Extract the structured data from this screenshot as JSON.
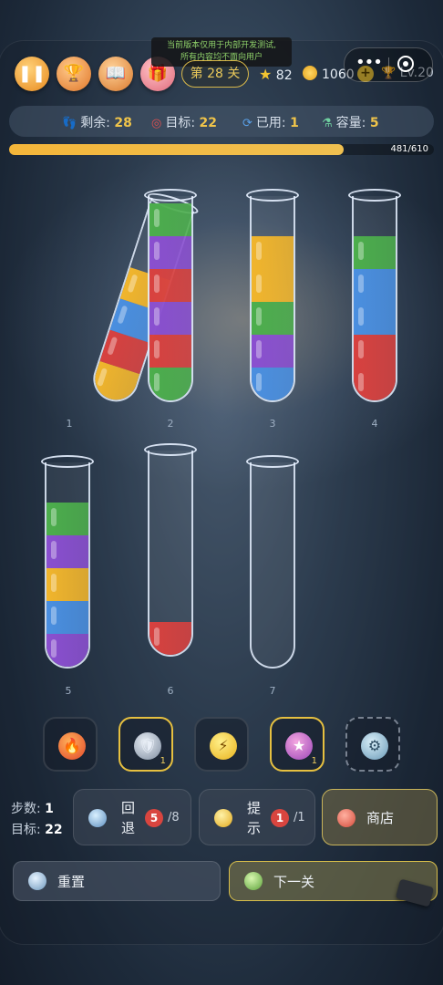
{
  "tooltip": {
    "line1": "当前版本仅用于内部开发测试,",
    "line2": "所有内容均不面向用户"
  },
  "header": {
    "level": "第 28 关",
    "stars": "82",
    "coins": "1060",
    "player_level": "Lv.20"
  },
  "info": {
    "remaining_label": "剩余:",
    "remaining": "28",
    "target_label": "目标:",
    "target": "22",
    "used_label": "已用:",
    "used": "1",
    "capacity_label": "容量:",
    "capacity": "5"
  },
  "progress": {
    "text": "481/610",
    "fraction": 0.788
  },
  "tubes": [
    {
      "label": "1",
      "layers": [
        "yellow",
        "red",
        "blue",
        "yellow"
      ]
    },
    {
      "label": "2",
      "layers": [
        "green",
        "red",
        "purple",
        "red",
        "purple",
        "green"
      ]
    },
    {
      "label": "3",
      "layers": [
        "blue",
        "purple",
        "green",
        "yellow",
        "yellow"
      ]
    },
    {
      "label": "4",
      "layers": [
        "red",
        "red",
        "blue",
        "blue",
        "green"
      ]
    },
    {
      "label": "5",
      "layers": [
        "purple",
        "blue",
        "yellow",
        "purple",
        "green"
      ]
    },
    {
      "label": "6",
      "layers": [
        "red"
      ]
    },
    {
      "label": "7",
      "layers": []
    }
  ],
  "colors": {
    "green": "#4cae4c",
    "purple": "#8a4fd0",
    "red": "#d8413f",
    "yellow": "#f1b52c",
    "blue": "#4a8fe0"
  },
  "powerups": [
    {
      "name": "fire-powerup",
      "icon": "fire-icon",
      "count": ""
    },
    {
      "name": "shield-powerup",
      "icon": "shield-icon",
      "count": "1"
    },
    {
      "name": "lightning-powerup",
      "icon": "lightning-icon",
      "count": ""
    },
    {
      "name": "star-powerup",
      "icon": "star-icon",
      "count": "1"
    },
    {
      "name": "settings-powerup",
      "icon": "gear-icon",
      "count": ""
    }
  ],
  "stats": {
    "steps_label": "步数:",
    "steps": "1",
    "goal_label": "目标:",
    "goal": "22"
  },
  "actions": {
    "undo_label_1": "回",
    "undo_label_2": "退",
    "undo_count": "5",
    "undo_total": "/8",
    "hint_label_1": "提",
    "hint_label_2": "示",
    "hint_count": "1",
    "hint_total": "/1",
    "shop_label": "商店",
    "reset_label": "重置",
    "next_label": "下一关"
  }
}
